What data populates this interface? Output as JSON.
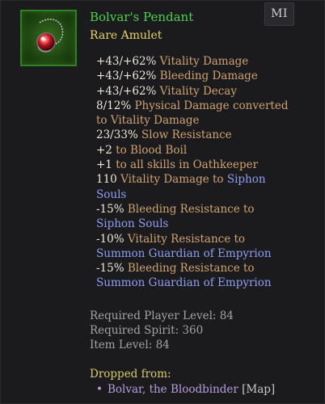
{
  "item": {
    "name": "Bolvar's Pendant",
    "type": "Rare Amulet",
    "badge": "MI",
    "icon": "pendant-icon"
  },
  "stats": [
    [
      {
        "t": "+43/+62% ",
        "c": "num"
      },
      {
        "t": "Vitality Damage",
        "c": "desc"
      }
    ],
    [
      {
        "t": "+43/+62% ",
        "c": "num"
      },
      {
        "t": "Bleeding Damage",
        "c": "desc"
      }
    ],
    [
      {
        "t": "+43/+62% ",
        "c": "num"
      },
      {
        "t": "Vitality Decay",
        "c": "desc"
      }
    ],
    [
      {
        "t": "8/12% ",
        "c": "num"
      },
      {
        "t": "Physical Damage converted",
        "c": "desc"
      }
    ],
    [
      {
        "t": "to Vitality Damage",
        "c": "desc"
      }
    ],
    [
      {
        "t": "23/33% ",
        "c": "num"
      },
      {
        "t": "Slow Resistance",
        "c": "desc"
      }
    ],
    [
      {
        "t": "+2 ",
        "c": "num"
      },
      {
        "t": "to Blood Boil",
        "c": "desc"
      }
    ],
    [
      {
        "t": "+1 ",
        "c": "num"
      },
      {
        "t": "to all skills in Oathkeeper",
        "c": "desc"
      }
    ],
    [
      {
        "t": "110 ",
        "c": "num"
      },
      {
        "t": "Vitality Damage to ",
        "c": "desc"
      },
      {
        "t": "Siphon",
        "c": "link"
      }
    ],
    [
      {
        "t": "Souls",
        "c": "link"
      }
    ],
    [
      {
        "t": "-15% ",
        "c": "num"
      },
      {
        "t": "Bleeding Resistance to",
        "c": "desc"
      }
    ],
    [
      {
        "t": "Siphon Souls",
        "c": "link"
      }
    ],
    [
      {
        "t": "-10% ",
        "c": "num"
      },
      {
        "t": "Vitality Resistance to",
        "c": "desc"
      }
    ],
    [
      {
        "t": "Summon Guardian of Empyrion",
        "c": "link"
      }
    ],
    [
      {
        "t": "-15% ",
        "c": "num"
      },
      {
        "t": "Bleeding Resistance to",
        "c": "desc"
      }
    ],
    [
      {
        "t": "Summon Guardian of Empyrion",
        "c": "link"
      }
    ]
  ],
  "requirements": {
    "player_level": "Required Player Level: 84",
    "spirit": "Required Spirit: 360",
    "item_level": "Item Level: 84"
  },
  "drops": {
    "label": "Dropped from:",
    "bullet": "•",
    "source": "Bolvar, the Bloodbinder",
    "tag": " [Map]"
  },
  "colors": {
    "name": "#4cd04f",
    "type": "#e5d36a",
    "number": "#ece7da",
    "description": "#cfa272",
    "skill_link": "#8f9ef3",
    "requirement": "#a3a3a3",
    "drop_source": "#b79ee0"
  }
}
